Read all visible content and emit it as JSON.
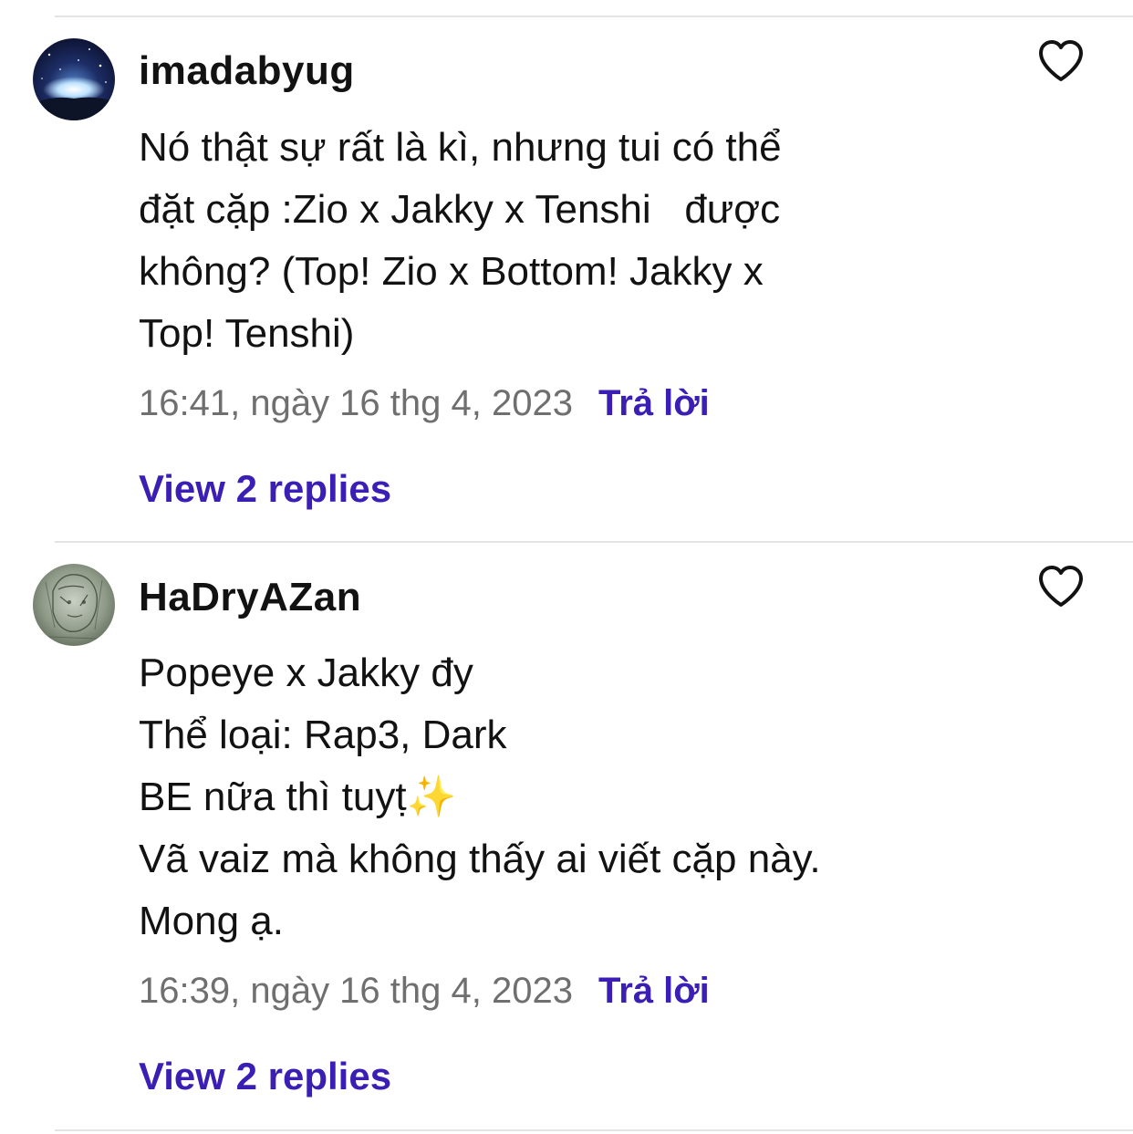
{
  "comments": [
    {
      "username": "imadabyug",
      "lines": [
        "Nó thật sự rất là kì, nhưng tui có thể",
        "đặt cặp :Zio x Jakky x Tenshi   được",
        "không? (Top! Zio x Bottom! Jakky x",
        "Top! Tenshi)"
      ],
      "timestamp": "16:41, ngày 16 thg 4, 2023",
      "reply_label": "Trả lời",
      "view_replies": "View 2 replies",
      "avatar_icon": "night-sky-avatar",
      "like_icon": "heart-outline-icon"
    },
    {
      "username": "HaDryAZan",
      "lines": [
        "Popeye x Jakky đy",
        "Thể loại: Rap3, Dark",
        "BE nữa thì tuyṭ✨",
        "Vã vaiz mà không thấy ai viết cặp này.",
        "Mong ạ."
      ],
      "timestamp": "16:39, ngày 16 thg 4, 2023",
      "reply_label": "Trả lời",
      "view_replies": "View 2 replies",
      "avatar_icon": "sketch-portrait-avatar",
      "like_icon": "heart-outline-icon"
    }
  ],
  "colors": {
    "link": "#3b1fb4",
    "timestamp": "#6f6f6f",
    "text": "#121212",
    "divider": "#e3e3e3"
  }
}
